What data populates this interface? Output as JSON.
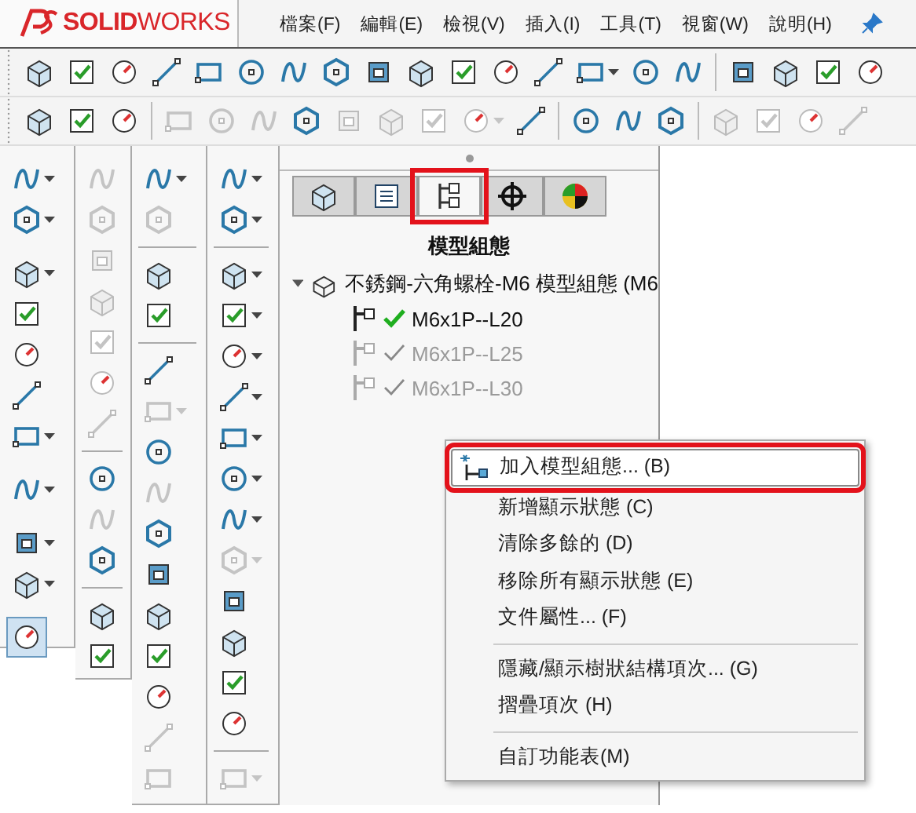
{
  "menu_bar": {
    "logo": "**SOLID**WORKS",
    "items": [
      "檔案(F)",
      "編輯(E)",
      "檢視(V)",
      "插入(I)",
      "工具(T)",
      "視窗(W)",
      "說明(H)"
    ]
  },
  "toolbar_1": [
    {
      "kind": "button",
      "disabled": false,
      "dropdown": false
    },
    {
      "kind": "button",
      "disabled": false,
      "dropdown": false
    },
    {
      "kind": "button",
      "disabled": false,
      "dropdown": false
    },
    {
      "kind": "button",
      "disabled": false,
      "dropdown": false
    },
    {
      "kind": "button",
      "disabled": false,
      "dropdown": false
    },
    {
      "kind": "button",
      "disabled": false,
      "dropdown": false
    },
    {
      "kind": "button",
      "disabled": false,
      "dropdown": false
    },
    {
      "kind": "button",
      "disabled": false,
      "dropdown": false
    },
    {
      "kind": "button",
      "disabled": false,
      "dropdown": false
    },
    {
      "kind": "button",
      "disabled": false,
      "dropdown": false
    },
    {
      "kind": "button",
      "disabled": false,
      "dropdown": false
    },
    {
      "kind": "button",
      "disabled": false,
      "dropdown": false
    },
    {
      "kind": "button",
      "disabled": false,
      "dropdown": false
    },
    {
      "kind": "button",
      "disabled": false,
      "dropdown": true
    },
    {
      "kind": "button",
      "disabled": false,
      "dropdown": false
    },
    {
      "kind": "button",
      "disabled": false,
      "dropdown": false
    },
    {
      "kind": "separator"
    },
    {
      "kind": "button",
      "disabled": false,
      "dropdown": false
    },
    {
      "kind": "button",
      "disabled": false,
      "dropdown": false
    },
    {
      "kind": "button",
      "disabled": false,
      "dropdown": false
    },
    {
      "kind": "button",
      "disabled": false,
      "dropdown": false
    }
  ],
  "toolbar_2": [
    {
      "kind": "button",
      "disabled": false,
      "dropdown": false
    },
    {
      "kind": "button",
      "disabled": false,
      "dropdown": false
    },
    {
      "kind": "button",
      "disabled": false,
      "dropdown": false
    },
    {
      "kind": "separator"
    },
    {
      "kind": "button",
      "disabled": true,
      "dropdown": false
    },
    {
      "kind": "button",
      "disabled": true,
      "dropdown": false
    },
    {
      "kind": "button",
      "disabled": true,
      "dropdown": false
    },
    {
      "kind": "button",
      "disabled": false,
      "dropdown": false
    },
    {
      "kind": "button",
      "disabled": true,
      "dropdown": false
    },
    {
      "kind": "button",
      "disabled": true,
      "dropdown": false
    },
    {
      "kind": "button",
      "disabled": true,
      "dropdown": false
    },
    {
      "kind": "button",
      "disabled": true,
      "dropdown": true
    },
    {
      "kind": "button",
      "disabled": false,
      "dropdown": false
    },
    {
      "kind": "separator"
    },
    {
      "kind": "button",
      "disabled": false,
      "dropdown": false
    },
    {
      "kind": "button",
      "disabled": false,
      "dropdown": false
    },
    {
      "kind": "button",
      "disabled": false,
      "dropdown": false
    },
    {
      "kind": "separator"
    },
    {
      "kind": "button",
      "disabled": true,
      "dropdown": false
    },
    {
      "kind": "button",
      "disabled": true,
      "dropdown": false
    },
    {
      "kind": "button",
      "disabled": true,
      "dropdown": false
    },
    {
      "kind": "button",
      "disabled": true,
      "dropdown": false
    }
  ],
  "side_toolbars": [
    [
      {
        "kind": "button",
        "disabled": false,
        "dropdown": true,
        "pressed": false
      },
      {
        "kind": "button",
        "disabled": false,
        "dropdown": true,
        "pressed": false
      },
      {
        "kind": "separator"
      },
      {
        "kind": "button",
        "disabled": false,
        "dropdown": true,
        "pressed": false
      },
      {
        "kind": "button",
        "disabled": false,
        "dropdown": false,
        "pressed": false
      },
      {
        "kind": "button",
        "disabled": false,
        "dropdown": false,
        "pressed": false
      },
      {
        "kind": "button",
        "disabled": false,
        "dropdown": false,
        "pressed": false
      },
      {
        "kind": "button",
        "disabled": false,
        "dropdown": true,
        "pressed": false
      },
      {
        "kind": "separator"
      },
      {
        "kind": "button",
        "disabled": false,
        "dropdown": true,
        "pressed": false
      },
      {
        "kind": "separator"
      },
      {
        "kind": "button",
        "disabled": false,
        "dropdown": true,
        "pressed": false
      },
      {
        "kind": "button",
        "disabled": false,
        "dropdown": true,
        "pressed": false
      },
      {
        "kind": "separator"
      },
      {
        "kind": "button",
        "disabled": false,
        "dropdown": false,
        "pressed": true
      }
    ],
    [
      {
        "kind": "button",
        "disabled": true,
        "dropdown": false,
        "pressed": false
      },
      {
        "kind": "button",
        "disabled": true,
        "dropdown": false,
        "pressed": false
      },
      {
        "kind": "button",
        "disabled": true,
        "dropdown": false,
        "pressed": false
      },
      {
        "kind": "button",
        "disabled": true,
        "dropdown": false,
        "pressed": false
      },
      {
        "kind": "button",
        "disabled": true,
        "dropdown": false,
        "pressed": false
      },
      {
        "kind": "button",
        "disabled": true,
        "dropdown": false,
        "pressed": false
      },
      {
        "kind": "button",
        "disabled": true,
        "dropdown": false,
        "pressed": false
      },
      {
        "kind": "separator"
      },
      {
        "kind": "button",
        "disabled": false,
        "dropdown": false,
        "pressed": false
      },
      {
        "kind": "button",
        "disabled": true,
        "dropdown": false,
        "pressed": false
      },
      {
        "kind": "button",
        "disabled": false,
        "dropdown": false,
        "pressed": false
      },
      {
        "kind": "separator"
      },
      {
        "kind": "button",
        "disabled": false,
        "dropdown": false,
        "pressed": false
      },
      {
        "kind": "button",
        "disabled": false,
        "dropdown": false,
        "pressed": false
      }
    ],
    [
      {
        "kind": "button",
        "disabled": false,
        "dropdown": true,
        "pressed": false
      },
      {
        "kind": "button",
        "disabled": true,
        "dropdown": false,
        "pressed": false
      },
      {
        "kind": "separator"
      },
      {
        "kind": "button",
        "disabled": false,
        "dropdown": false,
        "pressed": false
      },
      {
        "kind": "button",
        "disabled": false,
        "dropdown": false,
        "pressed": false
      },
      {
        "kind": "separator"
      },
      {
        "kind": "button",
        "disabled": false,
        "dropdown": false,
        "pressed": false
      },
      {
        "kind": "button",
        "disabled": true,
        "dropdown": true,
        "pressed": false
      },
      {
        "kind": "button",
        "disabled": false,
        "dropdown": false,
        "pressed": false
      },
      {
        "kind": "button",
        "disabled": true,
        "dropdown": false,
        "pressed": false
      },
      {
        "kind": "button",
        "disabled": false,
        "dropdown": false,
        "pressed": false
      },
      {
        "kind": "button",
        "disabled": false,
        "dropdown": false,
        "pressed": false
      },
      {
        "kind": "button",
        "disabled": false,
        "dropdown": false,
        "pressed": false
      },
      {
        "kind": "button",
        "disabled": false,
        "dropdown": false,
        "pressed": false
      },
      {
        "kind": "button",
        "disabled": false,
        "dropdown": false,
        "pressed": false
      },
      {
        "kind": "button",
        "disabled": true,
        "dropdown": false,
        "pressed": false
      },
      {
        "kind": "button",
        "disabled": true,
        "dropdown": false,
        "pressed": false
      }
    ],
    [
      {
        "kind": "button",
        "disabled": false,
        "dropdown": true,
        "pressed": false
      },
      {
        "kind": "button",
        "disabled": false,
        "dropdown": true,
        "pressed": false
      },
      {
        "kind": "separator"
      },
      {
        "kind": "button",
        "disabled": false,
        "dropdown": true,
        "pressed": false
      },
      {
        "kind": "button",
        "disabled": false,
        "dropdown": true,
        "pressed": false
      },
      {
        "kind": "button",
        "disabled": false,
        "dropdown": true,
        "pressed": false
      },
      {
        "kind": "button",
        "disabled": false,
        "dropdown": true,
        "pressed": false
      },
      {
        "kind": "button",
        "disabled": false,
        "dropdown": true,
        "pressed": false
      },
      {
        "kind": "button",
        "disabled": false,
        "dropdown": true,
        "pressed": false
      },
      {
        "kind": "button",
        "disabled": false,
        "dropdown": true,
        "pressed": false
      },
      {
        "kind": "button",
        "disabled": true,
        "dropdown": true,
        "pressed": false
      },
      {
        "kind": "button",
        "disabled": false,
        "dropdown": false,
        "pressed": false
      },
      {
        "kind": "button",
        "disabled": false,
        "dropdown": false,
        "pressed": false
      },
      {
        "kind": "button",
        "disabled": false,
        "dropdown": false,
        "pressed": false
      },
      {
        "kind": "button",
        "disabled": false,
        "dropdown": false,
        "pressed": false
      },
      {
        "kind": "separator"
      },
      {
        "kind": "button",
        "disabled": true,
        "dropdown": true,
        "pressed": false
      }
    ]
  ],
  "panel": {
    "tabs": [
      {
        "selected": false,
        "annotated": false
      },
      {
        "selected": false,
        "annotated": false
      },
      {
        "selected": true,
        "annotated": true
      },
      {
        "selected": false,
        "annotated": false
      },
      {
        "selected": false,
        "annotated": false
      }
    ],
    "title": "模型組態",
    "tree": {
      "label": "不銹鋼-六角螺栓-M6 模型組態  (M6",
      "expanded": true,
      "children": [
        {
          "label": "M6x1P--L20",
          "active": true
        },
        {
          "label": "M6x1P--L25",
          "active": false
        },
        {
          "label": "M6x1P--L30",
          "active": false
        }
      ]
    }
  },
  "context_menu": {
    "items": [
      {
        "kind": "item",
        "label": "加入模型組態... (B)",
        "annotated": true,
        "has_icon": true
      },
      {
        "kind": "item",
        "label": "新增顯示狀態 (C)",
        "annotated": false,
        "has_icon": false
      },
      {
        "kind": "item",
        "label": "清除多餘的 (D)",
        "annotated": false,
        "has_icon": false
      },
      {
        "kind": "item",
        "label": "移除所有顯示狀態 (E)",
        "annotated": false,
        "has_icon": false
      },
      {
        "kind": "item",
        "label": "文件屬性... (F)",
        "annotated": false,
        "has_icon": false
      },
      {
        "kind": "separator"
      },
      {
        "kind": "item",
        "label": "隱藏/顯示樹狀結構項次... (G)",
        "annotated": false,
        "has_icon": false
      },
      {
        "kind": "item",
        "label": "摺疊項次 (H)",
        "annotated": false,
        "has_icon": false
      },
      {
        "kind": "separator"
      },
      {
        "kind": "item",
        "label": "自訂功能表(M)",
        "annotated": false,
        "has_icon": false
      }
    ]
  }
}
